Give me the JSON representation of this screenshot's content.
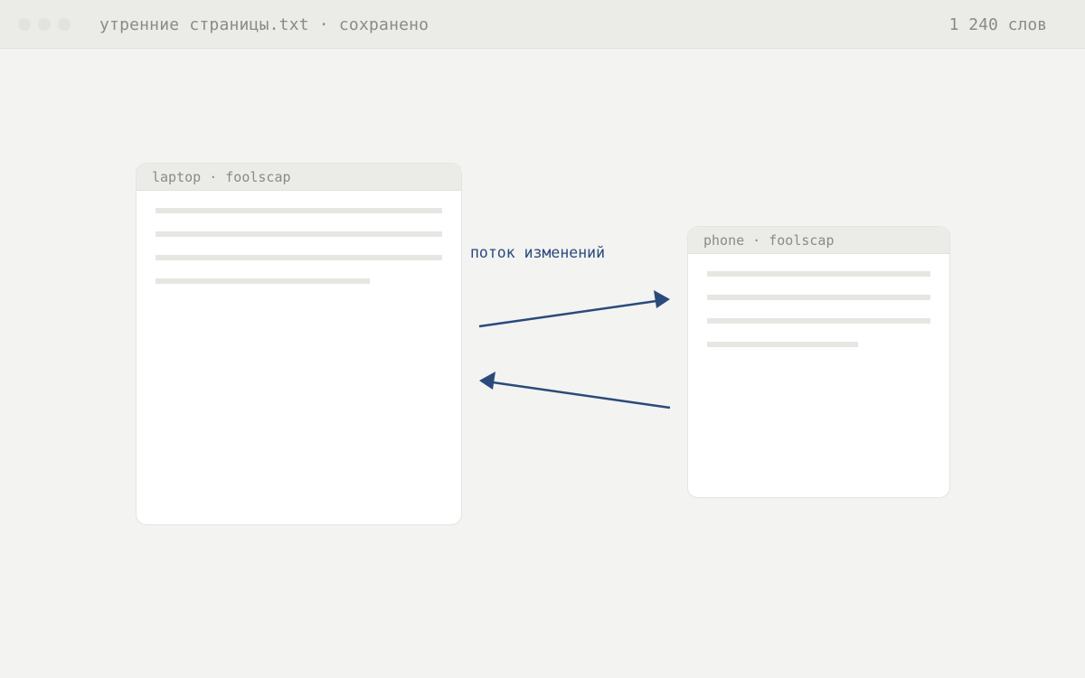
{
  "window": {
    "title": "утренние страницы.txt · сохранено",
    "word_count": "1 240 слов"
  },
  "devices": {
    "laptop": {
      "label": "laptop · foolscap"
    },
    "phone": {
      "label": "phone · foolscap"
    }
  },
  "flow": {
    "label": "поток изменений"
  },
  "colors": {
    "accent": "#2b4a7c",
    "background": "#f3f3f1",
    "titlebar": "#ebece8",
    "muted_text": "#8a8b87",
    "placeholder_line": "#e6e6e2"
  }
}
